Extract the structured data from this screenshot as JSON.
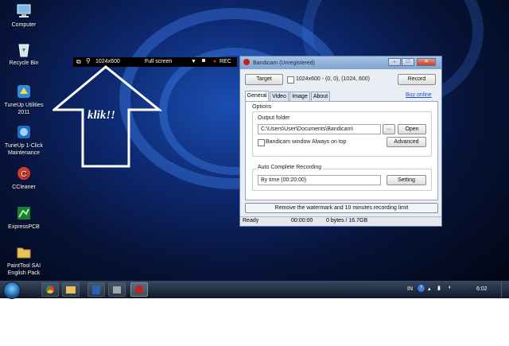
{
  "desktop_icons": [
    {
      "label": "Computer",
      "icon": "computer-icon"
    },
    {
      "label": "Recycle Bin",
      "icon": "recycle-bin-icon"
    },
    {
      "label": "TuneUp Utilities 2011",
      "icon": "tuneup-utilities-icon"
    },
    {
      "label": "TuneUp 1-Click Maintenance",
      "icon": "tuneup-maintenance-icon"
    },
    {
      "label": "CCleaner",
      "icon": "ccleaner-icon"
    },
    {
      "label": "ExpressPCB",
      "icon": "expresspcb-icon"
    },
    {
      "label": "PaintTool SAI English Pack",
      "icon": "folder-icon"
    }
  ],
  "recording_bar": {
    "size": "1024x600",
    "mode": "Full screen",
    "rec_label": "REC"
  },
  "annotation": {
    "text": "klik!!"
  },
  "bandicam": {
    "title": "Bandicam (Unregistered)",
    "target_button": "Target",
    "target_info": "1024x600 - (0, 0), (1024, 600)",
    "record_button": "Record",
    "tabs": [
      "General",
      "Video",
      "Image",
      "About"
    ],
    "active_tab": "General",
    "buy_online": "Buy online",
    "options_label": "Options",
    "output_folder_label": "Output folder",
    "output_folder_value": "C:\\Users\\User\\Documents\\Bandicam\\",
    "browse_button": "...",
    "open_button": "Open",
    "always_on_top_label": "Bandicam window Always on top",
    "advanced_button": "Advanced",
    "auto_complete_label": "Auto Complete Recording",
    "auto_complete_value": "By time (00:20:00)",
    "setting_button": "Setting",
    "watermark_notice": "Remove the watermark and 10 minutes recording limit",
    "status": {
      "state": "Ready",
      "time": "00:00:00",
      "size": "0 bytes / 16.7GB"
    }
  },
  "taskbar": {
    "language": "IN",
    "clock": "6:02"
  },
  "colors": {
    "accent": "#2b6cd4",
    "rec": "#e02020"
  }
}
